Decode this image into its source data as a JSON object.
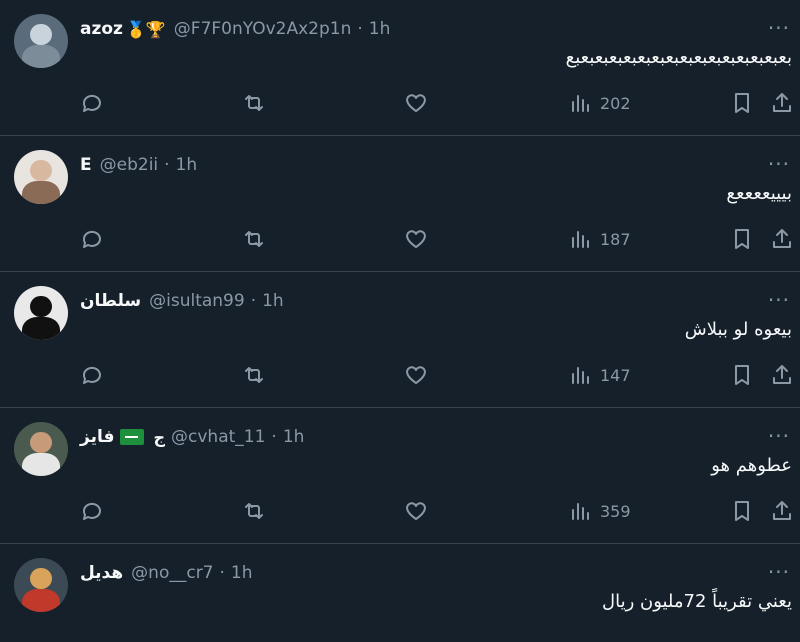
{
  "tweets": [
    {
      "name": "azoz",
      "badges": "🥇🏆",
      "handle": "@F7F0nYOv2Ax2p1n",
      "time": "1h",
      "text": "بعبعبعبعبعبعبعبعبعبعبعبعبعبعبعبع",
      "views": "202",
      "avatar": "avatar-azoz"
    },
    {
      "name": "E",
      "badges": "",
      "handle": "@eb2ii",
      "time": "1h",
      "text": "بيييععععع",
      "views": "187",
      "avatar": "avatar-e"
    },
    {
      "name": "سلطان",
      "badges": "",
      "handle": "@isultan99",
      "time": "1h",
      "text": "بيعوه لو ببلاش",
      "views": "147",
      "avatar": "avatar-sultan"
    },
    {
      "name": "فايز",
      "badges": "ج",
      "handle": "@cvhat_11",
      "time": "1h",
      "text": "عطوهم هو",
      "views": "359",
      "avatar": "avatar-fayez"
    },
    {
      "name": "هديل",
      "badges": "",
      "handle": "@no__cr7",
      "time": "1h",
      "text": "يعني تقريباً 72مليون ريال",
      "views": "",
      "avatar": "avatar-hadeel"
    }
  ],
  "ui": {
    "more": "···",
    "dot": "·"
  },
  "icons": [
    "reply-icon",
    "retweet-icon",
    "like-icon",
    "views-icon",
    "bookmark-icon",
    "share-icon",
    "more-icon"
  ]
}
